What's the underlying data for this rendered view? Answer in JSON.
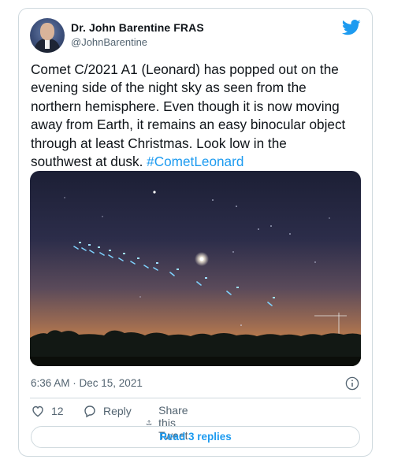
{
  "author": {
    "name": "Dr. John Barentine FRAS",
    "handle": "@JohnBarentine"
  },
  "tweet": {
    "text_lines": [
      "Comet C/2021 A1 (Leonard) has popped out on the",
      "evening side of the night sky as seen from the",
      "northern hemisphere. Even though it is now moving",
      "away from Earth, it remains an easy binocular object",
      "through at least Christmas. Look low in the"
    ],
    "last_line_text": "southwest at dusk. ",
    "hashtag": "#CometLeonard",
    "timestamp": "6:36 AM · Dec 15, 2021"
  },
  "actions": {
    "like_count": "12",
    "reply_label": "Reply",
    "share_label": "Share this Tweet"
  },
  "read_replies_label": "Read 3 replies",
  "icons": [
    "avatar",
    "twitter-bird-icon",
    "info-icon",
    "heart-icon",
    "reply-icon",
    "share-icon"
  ],
  "colors": {
    "accent": "#1d9bf0",
    "text": "#0f1419",
    "muted": "#536471",
    "border": "#cfd9de"
  }
}
